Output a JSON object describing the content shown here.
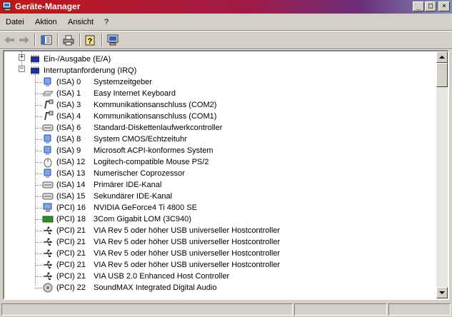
{
  "window": {
    "title": "Geräte-Manager",
    "controls": [
      "_",
      "□",
      "×"
    ]
  },
  "menu": {
    "items": [
      "Datei",
      "Aktion",
      "Ansicht",
      "?"
    ]
  },
  "toolbar": {
    "buttons": [
      "back-icon",
      "forward-icon",
      "properties-pane-icon",
      "print-icon",
      "help-icon",
      "computer-icon"
    ]
  },
  "tree": {
    "categories": [
      {
        "label": "Ein-/Ausgabe (E/A)",
        "expander": "+"
      },
      {
        "label": "Interruptanforderung (IRQ)",
        "expander": "−"
      }
    ],
    "devices": [
      {
        "irq": "(ISA)  0",
        "name": "Systemzeitgeber",
        "icon": "system-device-icon"
      },
      {
        "irq": "(ISA)  1",
        "name": "Easy Internet Keyboard",
        "icon": "keyboard-icon"
      },
      {
        "irq": "(ISA)  3",
        "name": "Kommunikationsanschluss (COM2)",
        "icon": "port-icon"
      },
      {
        "irq": "(ISA)  4",
        "name": "Kommunikationsanschluss (COM1)",
        "icon": "port-icon"
      },
      {
        "irq": "(ISA)  6",
        "name": "Standard-Diskettenlaufwerkcontroller",
        "icon": "disk-controller-icon"
      },
      {
        "irq": "(ISA)  8",
        "name": "System CMOS/Echtzeituhr",
        "icon": "system-device-icon"
      },
      {
        "irq": "(ISA)  9",
        "name": "Microsoft ACPI-konformes System",
        "icon": "system-device-icon"
      },
      {
        "irq": "(ISA) 12",
        "name": "Logitech-compatible Mouse PS/2",
        "icon": "mouse-icon"
      },
      {
        "irq": "(ISA) 13",
        "name": "Numerischer Coprozessor",
        "icon": "system-device-icon"
      },
      {
        "irq": "(ISA) 14",
        "name": "Primärer IDE-Kanal",
        "icon": "disk-controller-icon"
      },
      {
        "irq": "(ISA) 15",
        "name": "Sekundärer IDE-Kanal",
        "icon": "disk-controller-icon"
      },
      {
        "irq": "(PCI) 16",
        "name": "NVIDIA GeForce4 Ti 4800 SE",
        "icon": "display-adapter-icon"
      },
      {
        "irq": "(PCI) 18",
        "name": "3Com Gigabit LOM (3C940)",
        "icon": "network-adapter-icon"
      },
      {
        "irq": "(PCI) 21",
        "name": "VIA Rev 5 oder höher USB universeller Hostcontroller",
        "icon": "usb-icon"
      },
      {
        "irq": "(PCI) 21",
        "name": "VIA Rev 5 oder höher USB universeller Hostcontroller",
        "icon": "usb-icon"
      },
      {
        "irq": "(PCI) 21",
        "name": "VIA Rev 5 oder höher USB universeller Hostcontroller",
        "icon": "usb-icon"
      },
      {
        "irq": "(PCI) 21",
        "name": "VIA Rev 5 oder höher USB universeller Hostcontroller",
        "icon": "usb-icon"
      },
      {
        "irq": "(PCI) 21",
        "name": "VIA USB 2.0 Enhanced Host Controller",
        "icon": "usb-icon"
      },
      {
        "irq": "(PCI) 22",
        "name": "SoundMAX Integrated Digital Audio",
        "icon": "sound-icon"
      }
    ]
  },
  "colors": {
    "titlebar_start": "#c01818",
    "titlebar_end": "#7f8fb8",
    "face": "#d4d0c8"
  }
}
